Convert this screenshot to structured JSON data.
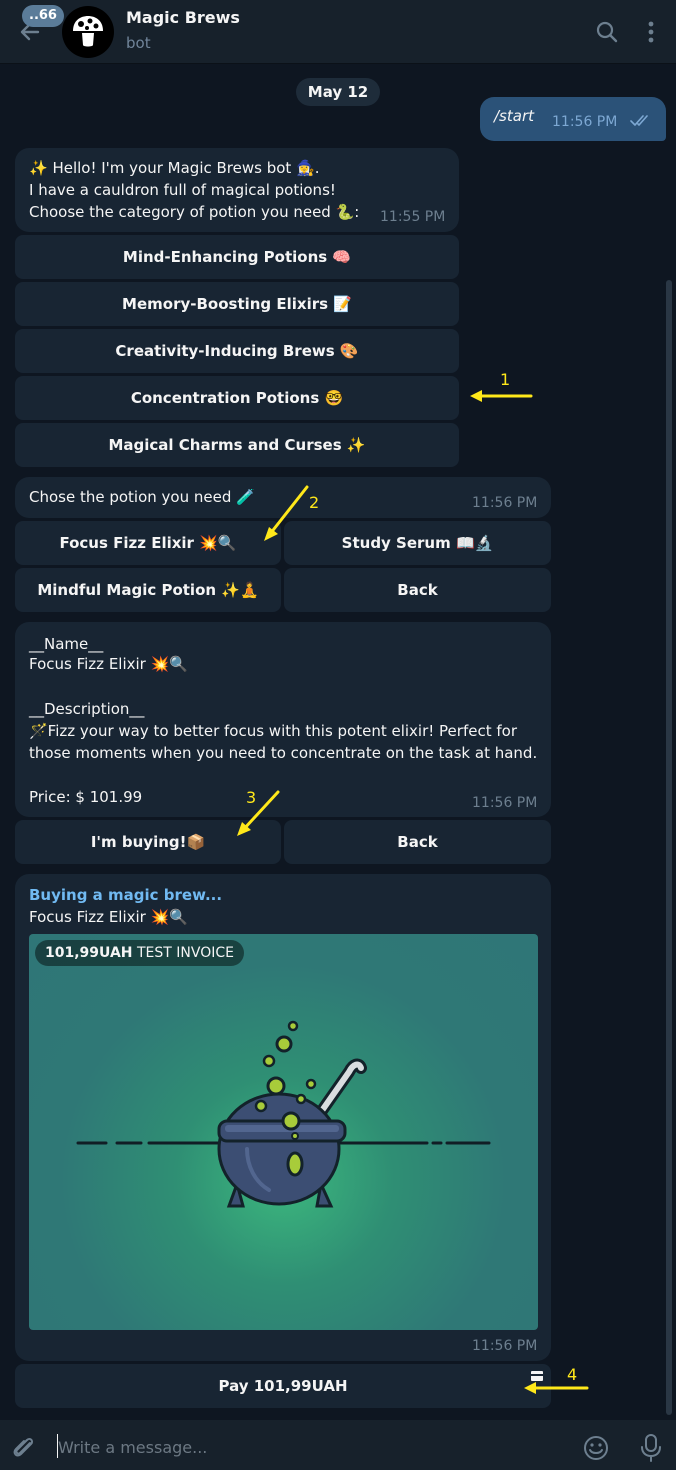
{
  "header": {
    "unread_count": "..66",
    "title": "Magic Brews",
    "status": "bot"
  },
  "date_separator": "May 12",
  "outgoing": {
    "text": "/start",
    "time": "11:56 PM"
  },
  "msg1": {
    "lines": [
      "✨ Hello! I'm your Magic Brews bot 🧙‍♀️.",
      "I have a cauldron full of magical potions!",
      "Choose the category of potion you need 🐍:"
    ],
    "time": "11:55 PM",
    "buttons": [
      "Mind-Enhancing Potions 🧠",
      "Memory-Boosting Elixirs 📝",
      "Creativity-Inducing Brews 🎨",
      "Concentration Potions 🤓",
      "Magical Charms and Curses ✨"
    ]
  },
  "msg2": {
    "text": "Chose the potion you need 🧪",
    "time": "11:56 PM",
    "buttons": [
      "Focus Fizz Elixir 💥🔍",
      "Study Serum 📖🔬",
      "Mindful Magic Potion ✨🧘",
      "Back"
    ]
  },
  "msg3": {
    "lines": [
      "__Name__",
      "Focus Fizz Elixir 💥🔍",
      "",
      "__Description__",
      "🪄Fizz your way to better focus with this potent elixir! Perfect for",
      "those moments when you need to concentrate on the task at hand.",
      "",
      "Price: $ 101.99"
    ],
    "time": "11:56 PM",
    "buttons": [
      "I'm buying!📦",
      "Back"
    ]
  },
  "msg4": {
    "title": "Buying a magic brew...",
    "subtitle": "Focus Fizz Elixir 💥🔍",
    "invoice_amount": "101,99UAH",
    "invoice_label": "TEST INVOICE",
    "time": "11:56 PM",
    "pay_button": "Pay 101,99UAH"
  },
  "annotations": [
    "1",
    "2",
    "3",
    "4"
  ],
  "input": {
    "placeholder": "Write a message..."
  },
  "colors": {
    "background": "#0e1621",
    "header": "#17212b",
    "bubble": "#182533",
    "outgoing_bubble": "#2b5278",
    "link": "#71baf2",
    "annotation": "#ffe81a"
  },
  "icons": [
    "back-arrow-icon",
    "mushroom-icon",
    "search-icon",
    "more-vertical-icon",
    "double-check-icon",
    "attach-icon",
    "emoji-icon",
    "microphone-icon",
    "card-icon"
  ]
}
